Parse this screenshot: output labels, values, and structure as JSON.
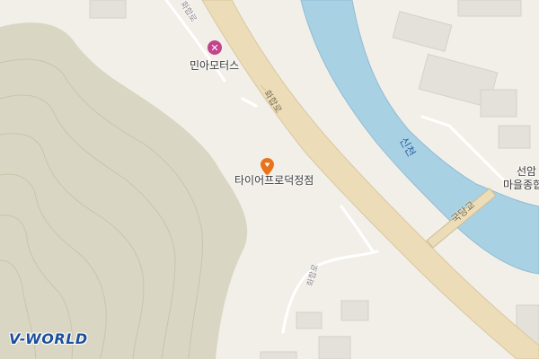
{
  "map": {
    "pois": [
      {
        "name": "민아모터스",
        "type": "repair",
        "icon": "wrench-icon",
        "color": "#c2448c"
      },
      {
        "name": "타이어프로덕정점",
        "type": "shop",
        "icon": "location-pin-icon",
        "color": "#e8731a"
      }
    ],
    "roads": {
      "main_label_top": "화합로",
      "main_label_mid": "화합로",
      "branch_label": "화합로",
      "bridge_label": "국당교"
    },
    "water": {
      "river_label": "신천"
    },
    "places": {
      "line1": "선암",
      "line2": "마을종합"
    },
    "colors": {
      "land": "#f2efe9",
      "mountain": "#d9d6c3",
      "road": "#ecdcb8",
      "road_edge": "#d8c8a0",
      "water": "#a9d1e4",
      "building": "#e4e0da"
    }
  },
  "branding": {
    "logo_text": "V-WORLD"
  }
}
